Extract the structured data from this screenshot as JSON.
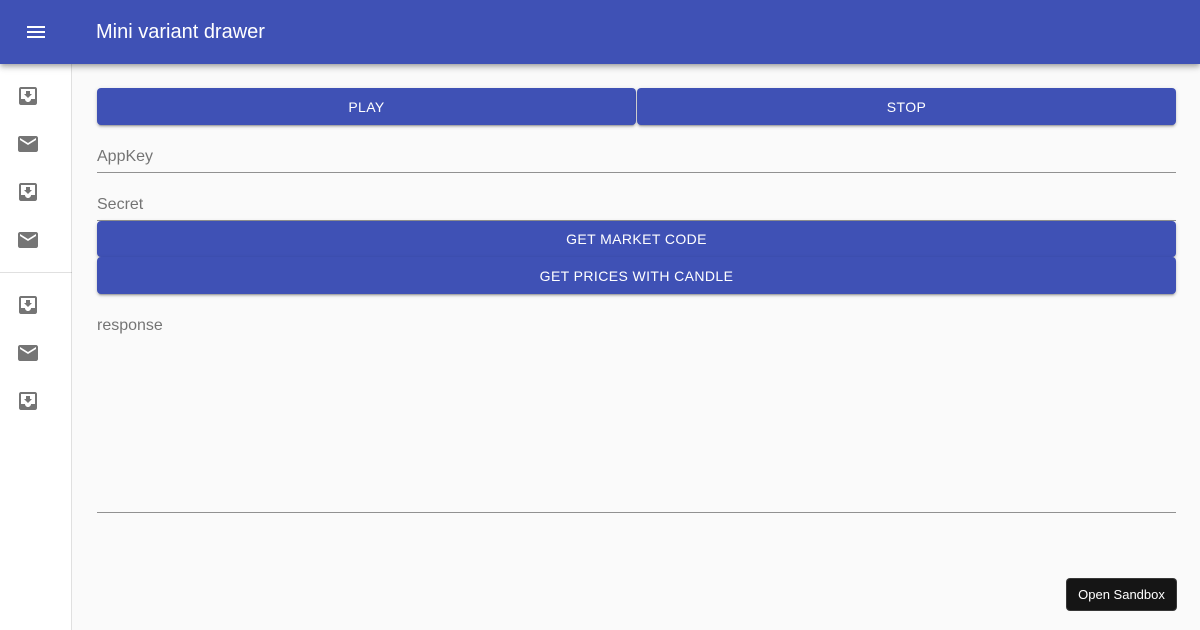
{
  "appbar": {
    "title": "Mini variant drawer",
    "menu_icon": "menu-icon"
  },
  "drawer": {
    "items": [
      {
        "icon": "inbox-icon"
      },
      {
        "icon": "mail-icon"
      },
      {
        "icon": "inbox-icon"
      },
      {
        "icon": "mail-icon"
      },
      {
        "icon": "inbox-icon"
      },
      {
        "icon": "mail-icon"
      },
      {
        "icon": "inbox-icon"
      }
    ]
  },
  "controls": {
    "play_label": "PLAY",
    "stop_label": "STOP",
    "get_market_code_label": "GET MARKET CODE",
    "get_prices_label": "GET PRICES WITH CANDLE"
  },
  "fields": {
    "appkey": {
      "label": "AppKey",
      "value": ""
    },
    "secret": {
      "label": "Secret",
      "value": ""
    },
    "response": {
      "label": "response",
      "value": ""
    }
  },
  "sandbox": {
    "label": "Open Sandbox"
  },
  "colors": {
    "primary": "#3f51b5",
    "background": "#fafafa",
    "icon": "#757575"
  }
}
